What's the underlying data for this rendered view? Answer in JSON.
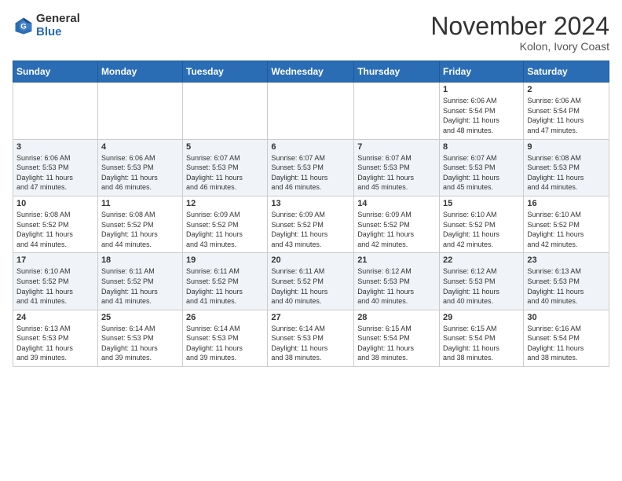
{
  "header": {
    "logo_general": "General",
    "logo_blue": "Blue",
    "month_title": "November 2024",
    "location": "Kolon, Ivory Coast"
  },
  "weekdays": [
    "Sunday",
    "Monday",
    "Tuesday",
    "Wednesday",
    "Thursday",
    "Friday",
    "Saturday"
  ],
  "weeks": [
    [
      {
        "day": "",
        "info": ""
      },
      {
        "day": "",
        "info": ""
      },
      {
        "day": "",
        "info": ""
      },
      {
        "day": "",
        "info": ""
      },
      {
        "day": "",
        "info": ""
      },
      {
        "day": "1",
        "info": "Sunrise: 6:06 AM\nSunset: 5:54 PM\nDaylight: 11 hours\nand 48 minutes."
      },
      {
        "day": "2",
        "info": "Sunrise: 6:06 AM\nSunset: 5:54 PM\nDaylight: 11 hours\nand 47 minutes."
      }
    ],
    [
      {
        "day": "3",
        "info": "Sunrise: 6:06 AM\nSunset: 5:53 PM\nDaylight: 11 hours\nand 47 minutes."
      },
      {
        "day": "4",
        "info": "Sunrise: 6:06 AM\nSunset: 5:53 PM\nDaylight: 11 hours\nand 46 minutes."
      },
      {
        "day": "5",
        "info": "Sunrise: 6:07 AM\nSunset: 5:53 PM\nDaylight: 11 hours\nand 46 minutes."
      },
      {
        "day": "6",
        "info": "Sunrise: 6:07 AM\nSunset: 5:53 PM\nDaylight: 11 hours\nand 46 minutes."
      },
      {
        "day": "7",
        "info": "Sunrise: 6:07 AM\nSunset: 5:53 PM\nDaylight: 11 hours\nand 45 minutes."
      },
      {
        "day": "8",
        "info": "Sunrise: 6:07 AM\nSunset: 5:53 PM\nDaylight: 11 hours\nand 45 minutes."
      },
      {
        "day": "9",
        "info": "Sunrise: 6:08 AM\nSunset: 5:53 PM\nDaylight: 11 hours\nand 44 minutes."
      }
    ],
    [
      {
        "day": "10",
        "info": "Sunrise: 6:08 AM\nSunset: 5:52 PM\nDaylight: 11 hours\nand 44 minutes."
      },
      {
        "day": "11",
        "info": "Sunrise: 6:08 AM\nSunset: 5:52 PM\nDaylight: 11 hours\nand 44 minutes."
      },
      {
        "day": "12",
        "info": "Sunrise: 6:09 AM\nSunset: 5:52 PM\nDaylight: 11 hours\nand 43 minutes."
      },
      {
        "day": "13",
        "info": "Sunrise: 6:09 AM\nSunset: 5:52 PM\nDaylight: 11 hours\nand 43 minutes."
      },
      {
        "day": "14",
        "info": "Sunrise: 6:09 AM\nSunset: 5:52 PM\nDaylight: 11 hours\nand 42 minutes."
      },
      {
        "day": "15",
        "info": "Sunrise: 6:10 AM\nSunset: 5:52 PM\nDaylight: 11 hours\nand 42 minutes."
      },
      {
        "day": "16",
        "info": "Sunrise: 6:10 AM\nSunset: 5:52 PM\nDaylight: 11 hours\nand 42 minutes."
      }
    ],
    [
      {
        "day": "17",
        "info": "Sunrise: 6:10 AM\nSunset: 5:52 PM\nDaylight: 11 hours\nand 41 minutes."
      },
      {
        "day": "18",
        "info": "Sunrise: 6:11 AM\nSunset: 5:52 PM\nDaylight: 11 hours\nand 41 minutes."
      },
      {
        "day": "19",
        "info": "Sunrise: 6:11 AM\nSunset: 5:52 PM\nDaylight: 11 hours\nand 41 minutes."
      },
      {
        "day": "20",
        "info": "Sunrise: 6:11 AM\nSunset: 5:52 PM\nDaylight: 11 hours\nand 40 minutes."
      },
      {
        "day": "21",
        "info": "Sunrise: 6:12 AM\nSunset: 5:53 PM\nDaylight: 11 hours\nand 40 minutes."
      },
      {
        "day": "22",
        "info": "Sunrise: 6:12 AM\nSunset: 5:53 PM\nDaylight: 11 hours\nand 40 minutes."
      },
      {
        "day": "23",
        "info": "Sunrise: 6:13 AM\nSunset: 5:53 PM\nDaylight: 11 hours\nand 40 minutes."
      }
    ],
    [
      {
        "day": "24",
        "info": "Sunrise: 6:13 AM\nSunset: 5:53 PM\nDaylight: 11 hours\nand 39 minutes."
      },
      {
        "day": "25",
        "info": "Sunrise: 6:14 AM\nSunset: 5:53 PM\nDaylight: 11 hours\nand 39 minutes."
      },
      {
        "day": "26",
        "info": "Sunrise: 6:14 AM\nSunset: 5:53 PM\nDaylight: 11 hours\nand 39 minutes."
      },
      {
        "day": "27",
        "info": "Sunrise: 6:14 AM\nSunset: 5:53 PM\nDaylight: 11 hours\nand 38 minutes."
      },
      {
        "day": "28",
        "info": "Sunrise: 6:15 AM\nSunset: 5:54 PM\nDaylight: 11 hours\nand 38 minutes."
      },
      {
        "day": "29",
        "info": "Sunrise: 6:15 AM\nSunset: 5:54 PM\nDaylight: 11 hours\nand 38 minutes."
      },
      {
        "day": "30",
        "info": "Sunrise: 6:16 AM\nSunset: 5:54 PM\nDaylight: 11 hours\nand 38 minutes."
      }
    ]
  ]
}
